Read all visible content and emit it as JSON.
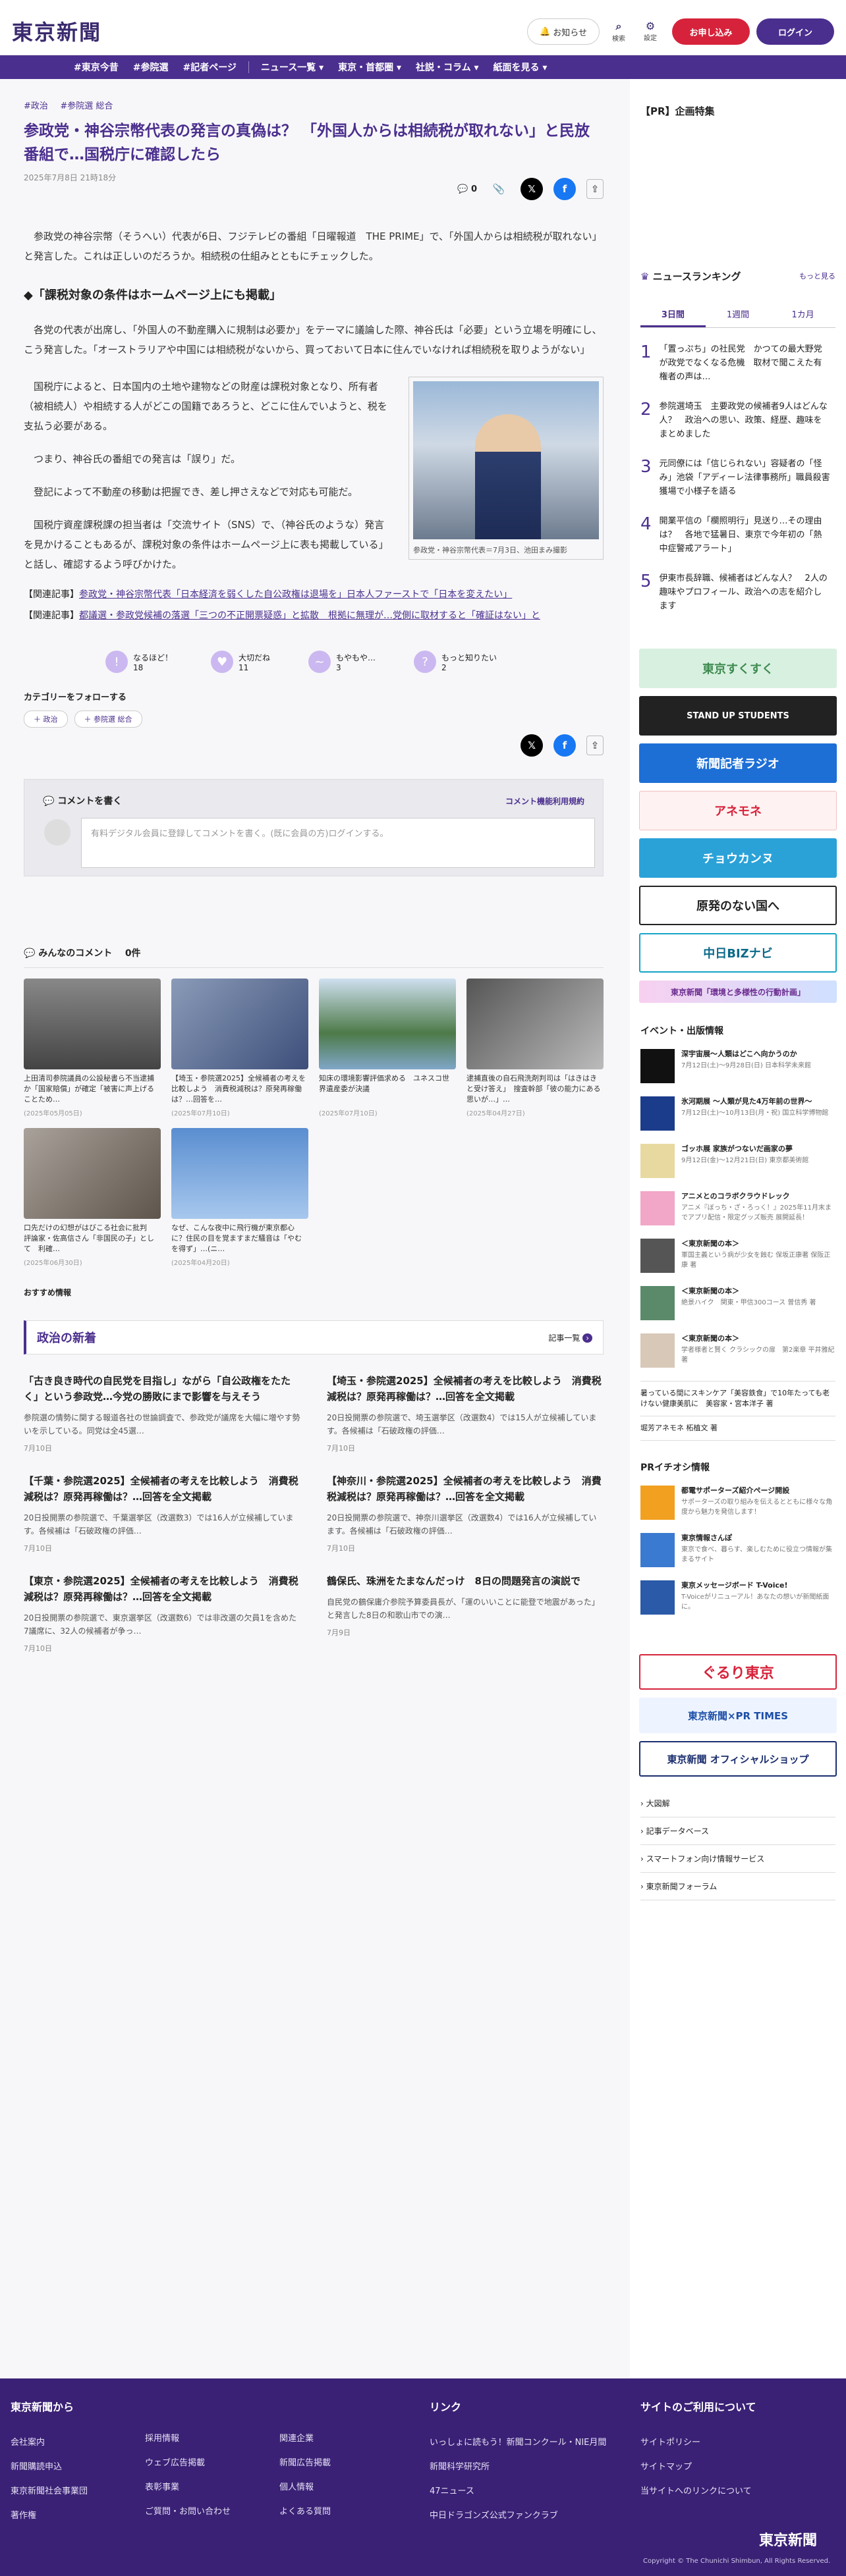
{
  "header": {
    "logo": "東京新聞",
    "notice": "お知らせ",
    "search": "検索",
    "settings": "設定",
    "subscribe": "お申し込み",
    "login": "ログイン"
  },
  "nav": [
    "#東京今昔",
    "#参院選",
    "#記者ページ",
    "ニュース一覧 ▾",
    "東京・首都圏 ▾",
    "社説・コラム ▾",
    "紙面を見る ▾"
  ],
  "article": {
    "tags": [
      "#政治",
      "#参院選 総合"
    ],
    "title": "参政党・神谷宗幣代表の発言の真偽は？ 「外国人からは相続税が取れない」と民放番組で…国税庁に確認したら",
    "date": "2025年7月8日 21時18分",
    "comment_count": "0",
    "p1": "参政党の神谷宗幣（そうへい）代表が6日、フジテレビの番組「日曜報道　THE PRIME」で、「外国人からは相続税が取れない」と発言した。これは正しいのだろうか。相続税の仕組みとともにチェックした。",
    "h2": "◆「課税対象の条件はホームページ上にも掲載」",
    "p2": "各党の代表が出席し、「外国人の不動産購入に規制は必要か」をテーマに議論した際、神谷氏は「必要」という立場を明確にし、こう発言した。「オーストラリアや中国には相続税がないから、買っておいて日本に住んでいなければ相続税を取りようがない」",
    "p3": "国税庁によると、日本国内の土地や建物などの財産は課税対象となり、所有者（被相続人）や相続する人がどこの国籍であろうと、どこに住んでいようと、税を支払う必要がある。",
    "p4": "つまり、神谷氏の番組での発言は「誤り」だ。",
    "p5": "登記によって不動産の移動は把握でき、差し押さえなどで対応も可能だ。",
    "p6": "国税庁資産課税課の担当者は「交流サイト（SNS）で、（神谷氏のような）発言を見かけることもあるが、課税対象の条件はホームページ上に表も掲載している」と話し、確認するよう呼びかけた。",
    "caption": "参政党・神谷宗幣代表＝7月3日、池田まみ撮影",
    "rel_label": "【関連記事】",
    "rel1": "参政党・神谷宗幣代表「日本経済を弱くした自公政権は退場を」日本人ファーストで「日本を変えたい」",
    "rel2": "都議選・参政党候補の落選「三つの不正開票疑惑」と拡散　根拠に無理が…党側に取材すると「確証はない」と"
  },
  "reactions": [
    {
      "label": "なるほど！",
      "count": "18"
    },
    {
      "label": "大切だね",
      "count": "11"
    },
    {
      "label": "もやもや…",
      "count": "3"
    },
    {
      "label": "もっと知りたい",
      "count": "2"
    }
  ],
  "follow": {
    "title": "カテゴリーをフォローする",
    "pills": [
      "＋ 政治",
      "＋ 参院選 総合"
    ]
  },
  "comment": {
    "title": "コメントを書く",
    "policy": "コメント機能利用規約",
    "placeholder": "有料デジタル会員に登録してコメントを書く。(既に会員の方)ログインする。",
    "list_title": "みんなのコメント",
    "list_count": "0件"
  },
  "related": [
    {
      "t": "上田清司参院議員の公設秘書ら不当逮捕か「国家賠償」が確定「被害に声上げることため…",
      "d": "(2025年05月05日)"
    },
    {
      "t": "【埼玉・参院選2025】全候補者の考えを比較しよう　消費税減税は？原発再稼働は？…回答を…",
      "d": "(2025年07月10日)"
    },
    {
      "t": "知床の環境影響評価求める　ユネスコ世界遺産委が決議",
      "d": "(2025年07月10日)"
    },
    {
      "t": "逮捕直後の自石飛洗剤判司は「はきはきと受け答え」　搜査幹部「彼の能力にある思いが…」…",
      "d": "(2025年04月27日)"
    },
    {
      "t": "口先だけの幻想がはびこる社会に批判　評論家・佐高信さん「非国民の子」として　利確…",
      "d": "(2025年06月30日)"
    },
    {
      "t": "なぜ、こんな夜中に飛行機が東京都心に？住民の目を覚ますまだ騒音は「やむを得ず」…(ニ…",
      "d": "(2025年04月20日)"
    }
  ],
  "recommend": "おすすめ情報",
  "politics": {
    "title": "政治の新着",
    "more": "記事一覧",
    "items": [
      {
        "t": "「古き良き時代の自民党を目指し」ながら「自公政権をたたく」という参政党…今党の勝敗にまで影響を与えそう",
        "d": "参院選の情勢に関する報道各社の世論調査で、参政党が議席を大幅に増やす勢いを示している。同党は全45選…",
        "dt": "7月10日"
      },
      {
        "t": "【埼玉・参院選2025】全候補者の考えを比較しよう　消費税減税は？原発再稼働は？…回答を全文掲載",
        "d": "20日投開票の参院選で、埼玉選挙区（改選数4）では15人が立候補しています。各候補は「石破政権の評価…",
        "dt": "7月10日"
      },
      {
        "t": "【千葉・参院選2025】全候補者の考えを比較しよう　消費税減税は？原発再稼働は？…回答を全文掲載",
        "d": "20日投開票の参院選で、千葉選挙区（改選数3）では16人が立候補しています。各候補は「石破政権の評価…",
        "dt": "7月10日"
      },
      {
        "t": "【神奈川・参院選2025】全候補者の考えを比較しよう　消費税減税は？原発再稼働は？…回答を全文掲載",
        "d": "20日投開票の参院選で、神奈川選挙区（改選数4）では16人が立候補しています。各候補は「石破政権の評価…",
        "dt": "7月10日"
      },
      {
        "t": "【東京・参院選2025】全候補者の考えを比較しよう　消費税減税は？原発再稼働は？…回答を全文掲載",
        "d": "20日投開票の参院選で、東京選挙区（改選数6）では非改選の欠員1を含めた7議席に、32人の候補者が争っ…",
        "dt": "7月10日"
      },
      {
        "t": "鶴保氏、珠洲をたまなんだっけ　8日の問題発言の演説で",
        "d": "自民党の鶴保庸介参院予算委員長が、「運のいいことに能登で地震があった」と発言した8日の和歌山市での演…",
        "dt": "7月9日"
      }
    ]
  },
  "sidebar": {
    "pr": "【PR】企画特集",
    "ranking": "ニュースランキング",
    "ranking_more": "もっと見る",
    "tabs": [
      "3日間",
      "1週間",
      "1カ月"
    ],
    "items": [
      "「置っぷち」の社民党　かつての最大野党が政党でなくなる危機　取材で聞こえた有権者の声は…",
      "参院選埼玉　主要政党の候補者9人はどんな人？　政治への思い、政策、経歴、趣味をまとめました",
      "元同僚には「信じられない」容疑者の「怪み」池袋「アディーレ法律事務所」職員殺害　獲場で小様子を語る",
      "開業平信の「欄照明行」見送り…その理由は？　各地で猛暑日、東京で今年初の「熱中症警戒アラート」",
      "伊東市長辞職、候補者はどんな人？　2人の趣味やプロフィール、政治への志を紹介します"
    ],
    "banners": [
      "東京すくすく",
      "STAND UP STUDENTS",
      "新聞記者ラジオ",
      "アネモネ",
      "チョウカンヌ",
      "原発のない国へ",
      "中日BIZナビ",
      "東京新聞「環境と多様性の行動計画」"
    ],
    "events_title": "イベント・出版情報",
    "events": [
      {
        "t": "深宇宙展〜人類はどこへ向かうのか",
        "d": "7月12日(土)〜9月28日(日) 日本科学未来館"
      },
      {
        "t": "氷河期展 〜人類が見た4万年前の世界〜",
        "d": "7月12日(土)〜10月13日(月・祝) 国立科学博物館"
      },
      {
        "t": "ゴッホ展 家族がつないだ画家の夢",
        "d": "9月12日(金)〜12月21日(日) 東京都美術館"
      },
      {
        "t": "アニメとのコラボクラウドレック",
        "d": "アニメ『ぼっち・ざ・ろっく！』2025年11月末までアプリ配信・限定グッズ販売 展開延長！"
      },
      {
        "t": "＜東京新聞の本＞",
        "d": "軍国主義という病が少女を蝕む 保坂正康著 保阪正康 著"
      },
      {
        "t": "＜東京新聞の本＞",
        "d": "絶景ハイク　関東・甲信300コース 曽信秀 著"
      },
      {
        "t": "＜東京新聞の本＞",
        "d": "学者様者と賢く クラシックの扉　第2楽章 平井雅紀 著"
      }
    ],
    "links1": [
      "暑っている間にスキンケア「美容鉄食」で10年たっても老けない健康美肌に　美容家・宮本洋子 著",
      "堀芳アネモネ 柘植文 著"
    ],
    "pr2": "PRイチオシ情報",
    "pr_items": [
      {
        "t": "都電サポーターズ紹介ページ開設",
        "d": "サポーターズの取り組みを伝えるとともに様々な角度から魅力を発信します！"
      },
      {
        "t": "東京情報さんぽ",
        "d": "東京で食べ、暮らす、楽しむために役立つ情報が集まるサイト"
      },
      {
        "t": "東京メッセージボード T-Voice!",
        "d": "T-Voiceがリニューアル！あなたの想いが新聞紙面に。"
      }
    ],
    "banners2": [
      "ぐるり東京",
      "東京新聞×PR TIMES",
      "東京新聞 オフィシャルショップ"
    ],
    "links2": [
      "大図解",
      "記事データベース",
      "スマートフォン向け情報サービス",
      "東京新聞フォーラム"
    ]
  },
  "footer": {
    "c1": "東京新聞から",
    "c1items": [
      "会社案内",
      "新聞購読申込",
      "東京新聞社会事業団",
      "著作権"
    ],
    "c1b": [
      "採用情報",
      "ウェブ広告掲載",
      "表彰事業",
      "ご質問・お問い合わせ"
    ],
    "c1c": [
      "関連企業",
      "新聞広告掲載",
      "個人情報",
      "よくある質問"
    ],
    "c2": "リンク",
    "c2items": [
      "いっしょに読もう！新聞コンクール・NIE月間",
      "新聞科学研究所",
      "47ニュース",
      "中日ドラゴンズ公式ファンクラブ"
    ],
    "c3": "サイトのご利用について",
    "c3items": [
      "サイトポリシー",
      "サイトマップ",
      "当サイトへのリンクについて"
    ],
    "logo": "東京新聞",
    "copy": "Copyright © The Chunichi Shimbun, All Rights Reserved."
  }
}
